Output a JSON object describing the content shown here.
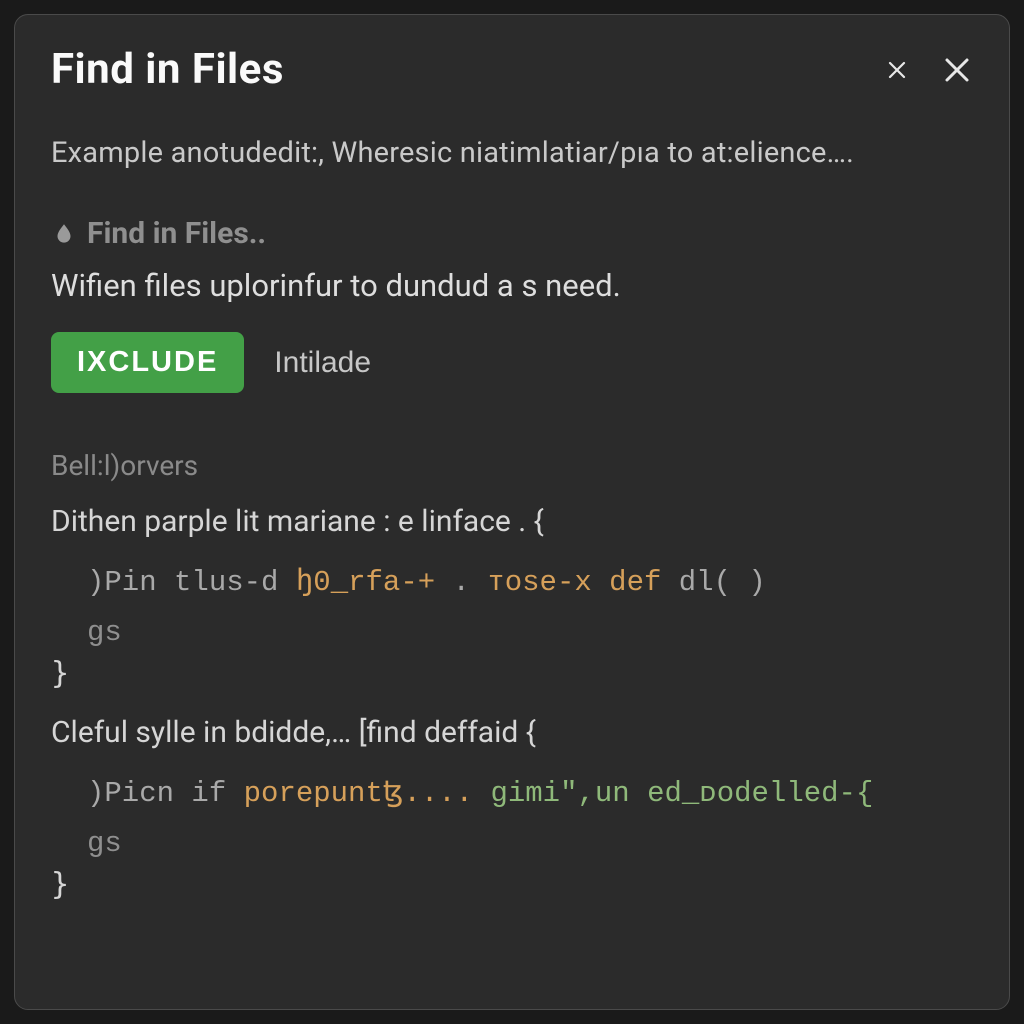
{
  "dialog": {
    "title": "Find in Files",
    "subtitle": "Example anotudedit:, Wheresic niatimlatiar/pıa to at:elience….",
    "section_label": "Find in Files..",
    "description": "Wifien files uplorinfur to dundud a s need.",
    "primary_button": "IXCLUDE",
    "secondary_button": "Intilade",
    "divider_label": "Bell:l)orvers"
  },
  "results": [
    {
      "header": "Dithen parple lit mariane : e linface . {",
      "code_line_prefix": ")Pin tlus-d ",
      "code_token_a": "ꜧ0_rfa-+",
      "code_mid": " . ",
      "code_token_b": "ᴛose-x",
      "code_token_c": " def ",
      "code_tail": "dl( )",
      "suffix": "gs",
      "close": "}"
    },
    {
      "header": "Cleful sylle in bdidde,… [find deffaid {",
      "code_line_prefix": ")Picn if ",
      "code_token_a": "porepuntꜩ....",
      "code_mid": " ",
      "code_token_b": "gimi",
      "code_token_c": "\",un ",
      "code_tail": "ed_ᴅodelled-{",
      "suffix": "gs",
      "close": "}"
    }
  ]
}
